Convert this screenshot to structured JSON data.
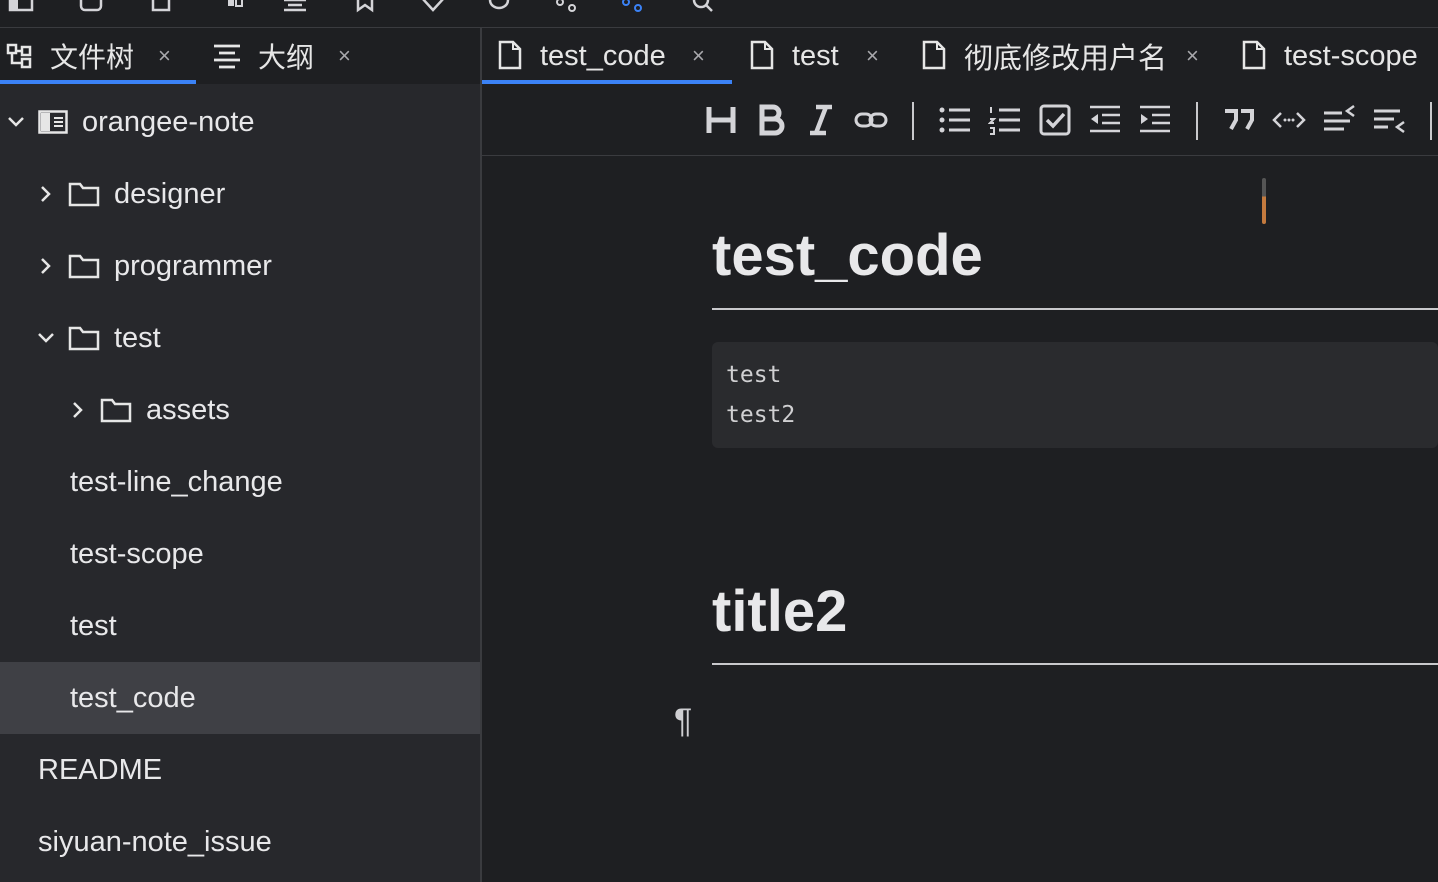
{
  "left_panel": {
    "tabs": [
      {
        "label": "文件树",
        "close": "×"
      },
      {
        "label": "大纲",
        "close": "×"
      }
    ],
    "tree": [
      {
        "name": "orangee-note"
      },
      {
        "name": "designer"
      },
      {
        "name": "programmer"
      },
      {
        "name": "test"
      },
      {
        "name": "assets"
      },
      {
        "name": "test-line_change"
      },
      {
        "name": "test-scope"
      },
      {
        "name": "test"
      },
      {
        "name": "test_code"
      },
      {
        "name": "README"
      },
      {
        "name": "siyuan-note_issue"
      }
    ]
  },
  "editor_tabs": [
    {
      "label": "test_code",
      "close": "×"
    },
    {
      "label": "test",
      "close": "×"
    },
    {
      "label": "彻底修改用户名",
      "close": "×"
    },
    {
      "label": "test-scope"
    }
  ],
  "toolbar": {
    "icons": [
      "heading-icon",
      "bold-icon",
      "italic-icon",
      "link-icon",
      "bullet-list-icon",
      "ordered-list-icon",
      "checklist-icon",
      "outdent-icon",
      "indent-icon",
      "quote-icon",
      "code-icon",
      "insert-before-icon",
      "insert-after-icon"
    ]
  },
  "document": {
    "heading1": "test_code",
    "code_lines": [
      "test",
      "test2"
    ],
    "heading2": "title2",
    "pilcrow": "¶"
  },
  "colors": {
    "accent": "#3b82f6",
    "background": "#1e1f22",
    "panel": "#27282c",
    "selected_row": "#3f4045"
  }
}
